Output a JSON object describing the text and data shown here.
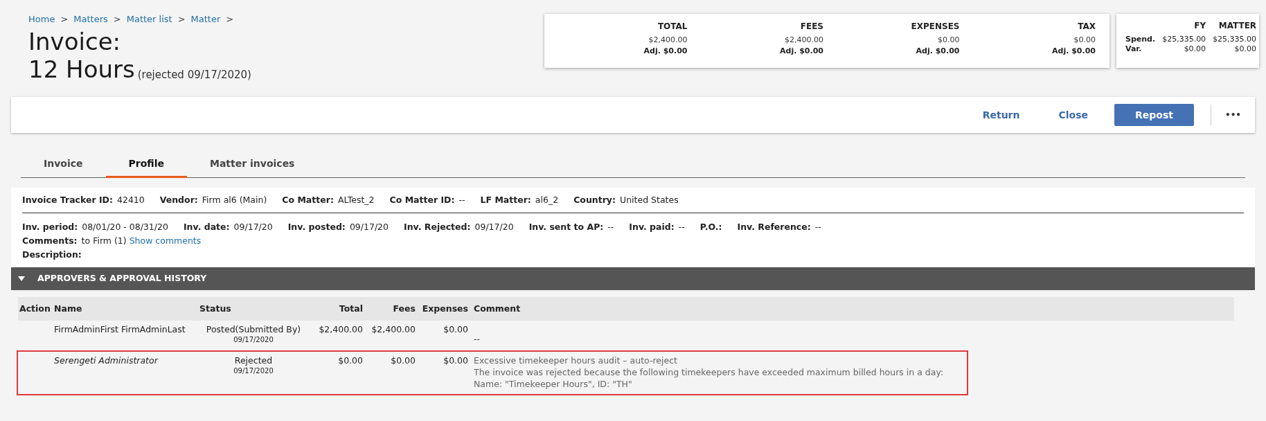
{
  "breadcrumb": [
    "Home",
    "Matters",
    "Matter list",
    "Matter"
  ],
  "breadcrumb_separator": ">",
  "title": {
    "line1": "Invoice:",
    "line2": "12 Hours",
    "note": "(rejected 09/17/2020)"
  },
  "totals": [
    {
      "label": "TOTAL",
      "amount": "$2,400.00",
      "adjusted": "Adj. $0.00"
    },
    {
      "label": "FEES",
      "amount": "$2,400.00",
      "adjusted": "Adj. $0.00"
    },
    {
      "label": "EXPENSES",
      "amount": "$0.00",
      "adjusted": "Adj. $0.00"
    },
    {
      "label": "TAX",
      "amount": "$0.00",
      "adjusted": "Adj. $0.00"
    }
  ],
  "budget": {
    "columns": [
      "FY",
      "MATTER"
    ],
    "rows": [
      {
        "label": "Spend.",
        "values": [
          "$25,335.00",
          "$25,335.00"
        ]
      },
      {
        "label": "Var.",
        "values": [
          "$0.00",
          "$0.00"
        ]
      }
    ]
  },
  "toolbar": {
    "buttons": [
      {
        "label": "Return",
        "kind": "link"
      },
      {
        "label": "Close",
        "kind": "link"
      },
      {
        "label": "Repost",
        "kind": "primary"
      }
    ],
    "more": "•••"
  },
  "tabs": [
    {
      "label": "Invoice",
      "selected": false
    },
    {
      "label": "Profile",
      "selected": true
    },
    {
      "label": "Matter invoices",
      "selected": false
    }
  ],
  "profile": {
    "header_fields": [
      {
        "label": "Invoice Tracker ID:",
        "value": "42410"
      },
      {
        "label": "Vendor:",
        "value": "Firm al6 (Main)"
      },
      {
        "label": "Co Matter:",
        "value": "ALTest_2"
      },
      {
        "label": "Co Matter ID:",
        "value": "--"
      },
      {
        "label": "LF Matter:",
        "value": "al6_2"
      },
      {
        "label": "Country:",
        "value": "United States"
      }
    ],
    "date_fields": [
      {
        "label": "Inv. period:",
        "value": "08/01/20 - 08/31/20"
      },
      {
        "label": "Inv. date:",
        "value": "09/17/20"
      },
      {
        "label": "Inv. posted:",
        "value": "09/17/20"
      },
      {
        "label": "Inv. Rejected:",
        "value": "09/17/20"
      },
      {
        "label": "Inv. sent to AP:",
        "value": "--"
      },
      {
        "label": "Inv. paid:",
        "value": "--"
      },
      {
        "label": "P.O.:"
      },
      {
        "label": "Inv. Reference:",
        "value": "--"
      }
    ],
    "comments": {
      "label": "Comments:",
      "value": "to Firm (1)",
      "link": "Show comments"
    },
    "description": {
      "label": "Description:"
    }
  },
  "approvals": {
    "title": "APPROVERS & APPROVAL HISTORY",
    "expanded": true,
    "columns": [
      "Action",
      "Name",
      "Status",
      "Total",
      "Fees",
      "Expenses",
      "Comment"
    ],
    "rows": [
      {
        "name": "FirmAdminFirst FirmAdminLast",
        "system": false,
        "status": "Posted(Submitted By)",
        "date": "09/17/2020",
        "total": "$2,400.00",
        "fees": "$2,400.00",
        "expenses": "$0.00",
        "comment": [
          "--"
        ],
        "highlighted": false
      },
      {
        "name": "Serengeti Administrator",
        "system": true,
        "status": "Rejected",
        "date": "09/17/2020",
        "total": "$0.00",
        "fees": "$0.00",
        "expenses": "$0.00",
        "comment": [
          "Excessive timekeeper hours audit – auto-reject",
          "The invoice was rejected because the following timekeepers have exceeded maximum billed hours in a day:",
          "Name: \"Timekeeper Hours\", ID: \"TH\""
        ],
        "highlighted": true
      }
    ]
  }
}
